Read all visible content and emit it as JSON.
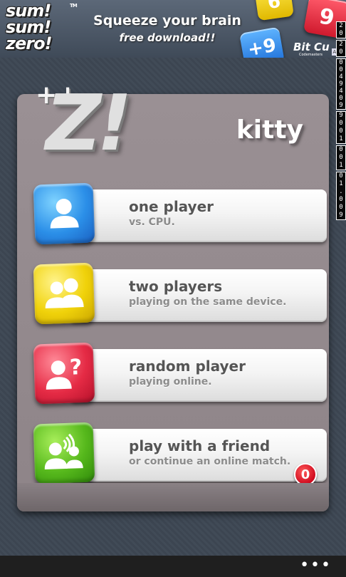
{
  "ad": {
    "logo_line1": "sum!",
    "logo_line2": "sum!",
    "logo_line3": "zero!",
    "logo_tm": "TM",
    "headline": "Squeeze your brain",
    "subline": "free download!!",
    "tile_yellow": "6",
    "tile_red": "9",
    "tile_blue": "+9",
    "brand": "Bit Cu",
    "brand_sub": "Codemasters",
    "ad_marker": "Ad"
  },
  "debug_strip": [
    "20",
    "20",
    "0049409",
    "9001",
    "001",
    "01.009"
  ],
  "header": {
    "logo_text": "Z!",
    "logo_plus1": "+",
    "logo_plus2": "+",
    "username": "kitty"
  },
  "menu": [
    {
      "id": "one-player",
      "title": "one player",
      "subtitle": "vs. CPU.",
      "icon": "single-person-icon",
      "color": "blue"
    },
    {
      "id": "two-players",
      "title": "two players",
      "subtitle": "playing on the same device.",
      "icon": "two-persons-icon",
      "color": "yellow"
    },
    {
      "id": "random-player",
      "title": "random player",
      "subtitle": "playing online.",
      "icon": "random-person-icon",
      "color": "red"
    },
    {
      "id": "play-with-friend",
      "title": "play with a friend",
      "subtitle": "or continue an online match.",
      "icon": "friend-calling-icon",
      "color": "green",
      "badge": "0"
    }
  ],
  "appbar": {
    "more_label": "•••"
  }
}
